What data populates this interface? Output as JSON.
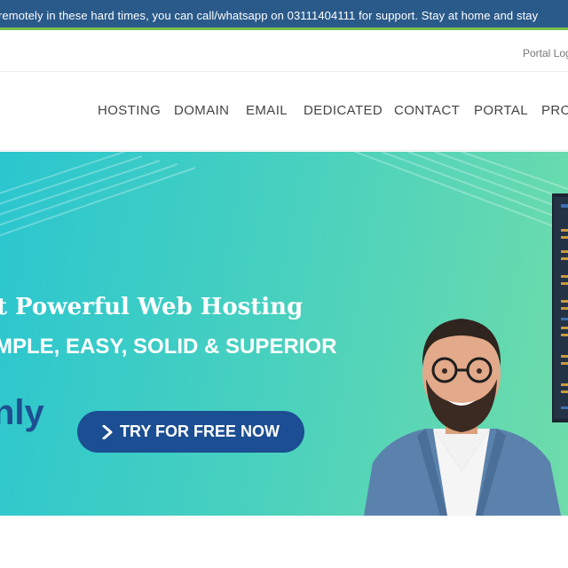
{
  "announcement": {
    "text": "remotely in these hard times, you can call/whatsapp on 03111404111 for support. Stay at home and stay"
  },
  "utility": {
    "portal_login": "Portal Login"
  },
  "nav": {
    "items": [
      {
        "label": "HOSTING"
      },
      {
        "label": "DOMAIN"
      },
      {
        "label": "EMAIL"
      },
      {
        "label": "DEDICATED"
      },
      {
        "label": "CONTACT"
      },
      {
        "label": "PORTAL"
      },
      {
        "label": "PRO"
      }
    ]
  },
  "hero": {
    "title": "t Powerful Web Hosting",
    "subtitle": "MPLE, EASY, SOLID & SUPERIOR",
    "price_text": "nly",
    "cta_label": "TRY FOR FREE NOW",
    "cta_icon": "chevron-right-icon"
  },
  "colors": {
    "announce_bg": "#2a5a8a",
    "announce_border": "#7cc04a",
    "hero_gradient_start": "#2bc6cf",
    "hero_gradient_end": "#6fdcaa",
    "cta_bg": "#1b4e93",
    "price_text": "#1d4f91"
  }
}
